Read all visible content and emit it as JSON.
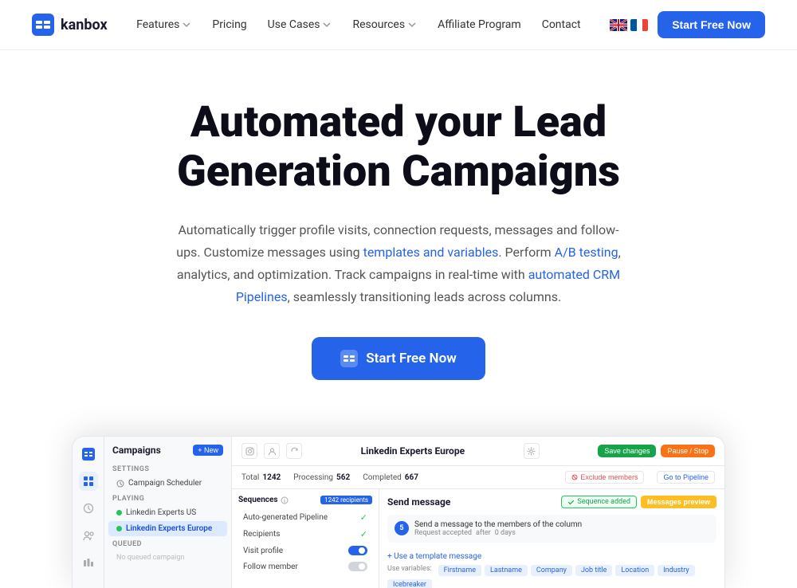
{
  "nav": {
    "logo_text": "kanbox",
    "links": [
      {
        "label": "Features",
        "has_dropdown": true
      },
      {
        "label": "Pricing",
        "has_dropdown": false
      },
      {
        "label": "Use Cases",
        "has_dropdown": true
      },
      {
        "label": "Resources",
        "has_dropdown": true
      },
      {
        "label": "Affiliate Program",
        "has_dropdown": false
      },
      {
        "label": "Contact",
        "has_dropdown": false
      }
    ],
    "cta_label": "Start  Free Now"
  },
  "hero": {
    "headline_line1": "Automated your Lead",
    "headline_line2": "Generation Campaigns",
    "description": "Automatically trigger profile visits, connection requests, messages and follow-ups. Customize messages using ",
    "link1_text": "templates and variables",
    "description2": ". Perform ",
    "link2_text": "A/B testing",
    "description3": ", analytics, and optimization. Track campaigns in real-time with ",
    "link3_text": "automated CRM Pipelines",
    "description4": ", seamlessly transitioning leads across columns.",
    "cta_label": "Start  Free Now"
  },
  "dashboard": {
    "campaign_name": "Linkedin Experts Europe",
    "new_btn": "+ New",
    "stats": {
      "total_label": "Total",
      "total_value": "1242",
      "processing_label": "Processing",
      "processing_value": "562",
      "completed_label": "Completed",
      "completed_value": "667"
    },
    "btn_save": "Save changes",
    "btn_pause": "Pause / Stop",
    "btn_exclude": "Exclude members",
    "btn_pipeline": "Go to Pipeline",
    "sequences_title": "Sequences",
    "sequences_badge": "1242 recipients",
    "seq_rows": [
      {
        "label": "Auto-generated Pipeline",
        "status": "check"
      },
      {
        "label": "Recipients",
        "status": "check"
      },
      {
        "label": "Visit profile",
        "status": "toggle"
      },
      {
        "label": "Follow member",
        "status": "toggle-off"
      }
    ],
    "send_msg_title": "Send message",
    "seq_added_label": "Sequence added",
    "msg_preview_label": "Messages preview",
    "msg_text": "Send a message to the members of the column",
    "msg_meta1": "Request accepted",
    "msg_meta2": "after",
    "msg_meta3": "0 days",
    "template_link": "+ Use a template message",
    "use_var_label": "Use variables:",
    "variables": [
      "Firstname",
      "Lastname",
      "Company",
      "Job title",
      "Location",
      "Industry",
      "Icebreaker"
    ],
    "settings_label": "SETTINGS",
    "campaign_scheduler_label": "Campaign Scheduler",
    "playing_label": "PLAYING",
    "campaign1": "Linkedin Experts US",
    "campaign2": "Linkedin Experts Europe",
    "queued_label": "QUEUED",
    "campaign_queued": "No queued campaign"
  }
}
